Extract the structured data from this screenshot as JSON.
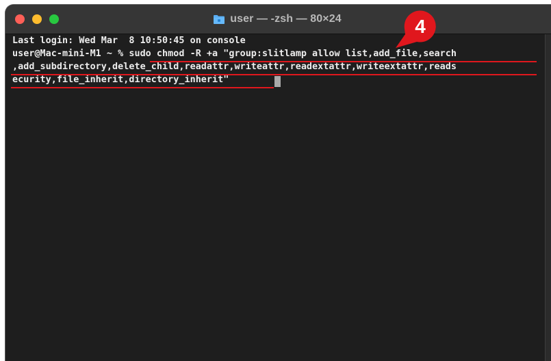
{
  "window": {
    "title": "user — -zsh — 80×24",
    "traffic_lights": {
      "close_color": "#fe5f57",
      "minimize_color": "#febc2e",
      "zoom_color": "#28c840"
    },
    "folder_icon": "folder-icon"
  },
  "terminal": {
    "background": "#1e1e1e",
    "lines": [
      "Last login: Wed Mar  8 10:50:45 on console",
      "user@Mac-mini-M1 ~ % sudo chmod -R +a \"group:slitlamp allow list,add_file,search",
      ",add_subdirectory,delete_child,readattr,writeattr,readextattr,writeextattr,reads",
      "ecurity,file_inherit,directory_inherit\" "
    ]
  },
  "annotation": {
    "step_number": "4",
    "color": "#e0171d"
  }
}
